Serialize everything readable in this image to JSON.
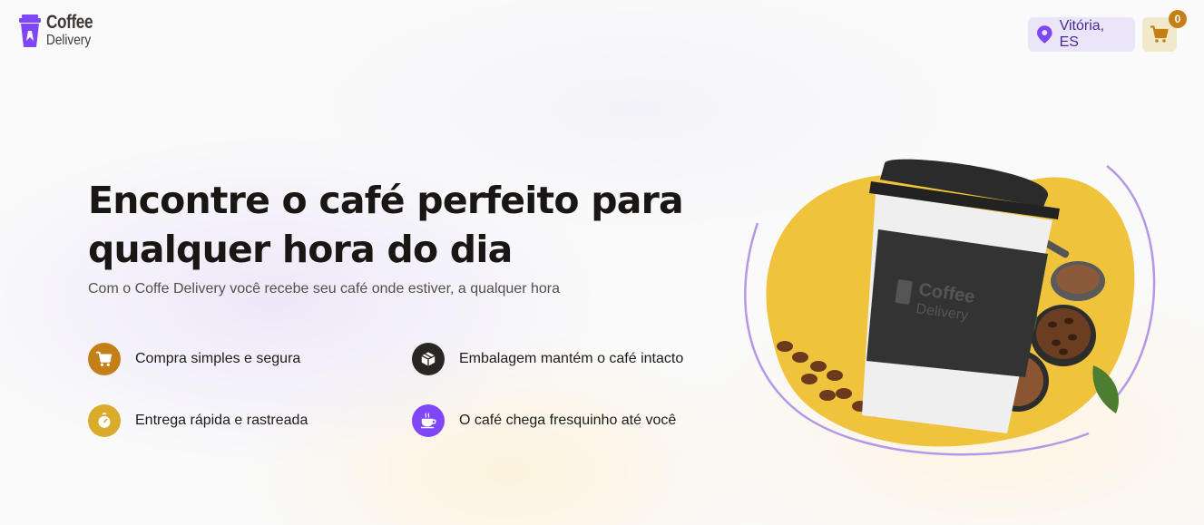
{
  "header": {
    "logo": {
      "line1": "Coffee",
      "line2": "Delivery"
    },
    "location": {
      "label": "Vitória, ES",
      "icon": "map-pin-icon"
    },
    "cart": {
      "count": "0",
      "icon": "shopping-cart-icon"
    }
  },
  "hero": {
    "title": "Encontre o café perfeito para qualquer hora do dia",
    "subtitle": "Com o Coffe Delivery você recebe seu café onde estiver, a qualquer hora",
    "features": [
      {
        "label": "Compra simples e segura",
        "icon": "shopping-cart-icon",
        "color": "#c47f17"
      },
      {
        "label": "Embalagem mantém o café intacto",
        "icon": "package-icon",
        "color": "#2a2624"
      },
      {
        "label": "Entrega rápida e rastreada",
        "icon": "timer-icon",
        "color": "#dbac2c"
      },
      {
        "label": "O café chega fresquinho até você",
        "icon": "coffee-icon",
        "color": "#8047f8"
      }
    ]
  },
  "illustration": {
    "cup_logo": {
      "line1": "Coffee",
      "line2": "Delivery"
    },
    "colors": {
      "blob": "#f0c33c",
      "arc": "#b597e8",
      "sleeve": "#333333"
    }
  }
}
